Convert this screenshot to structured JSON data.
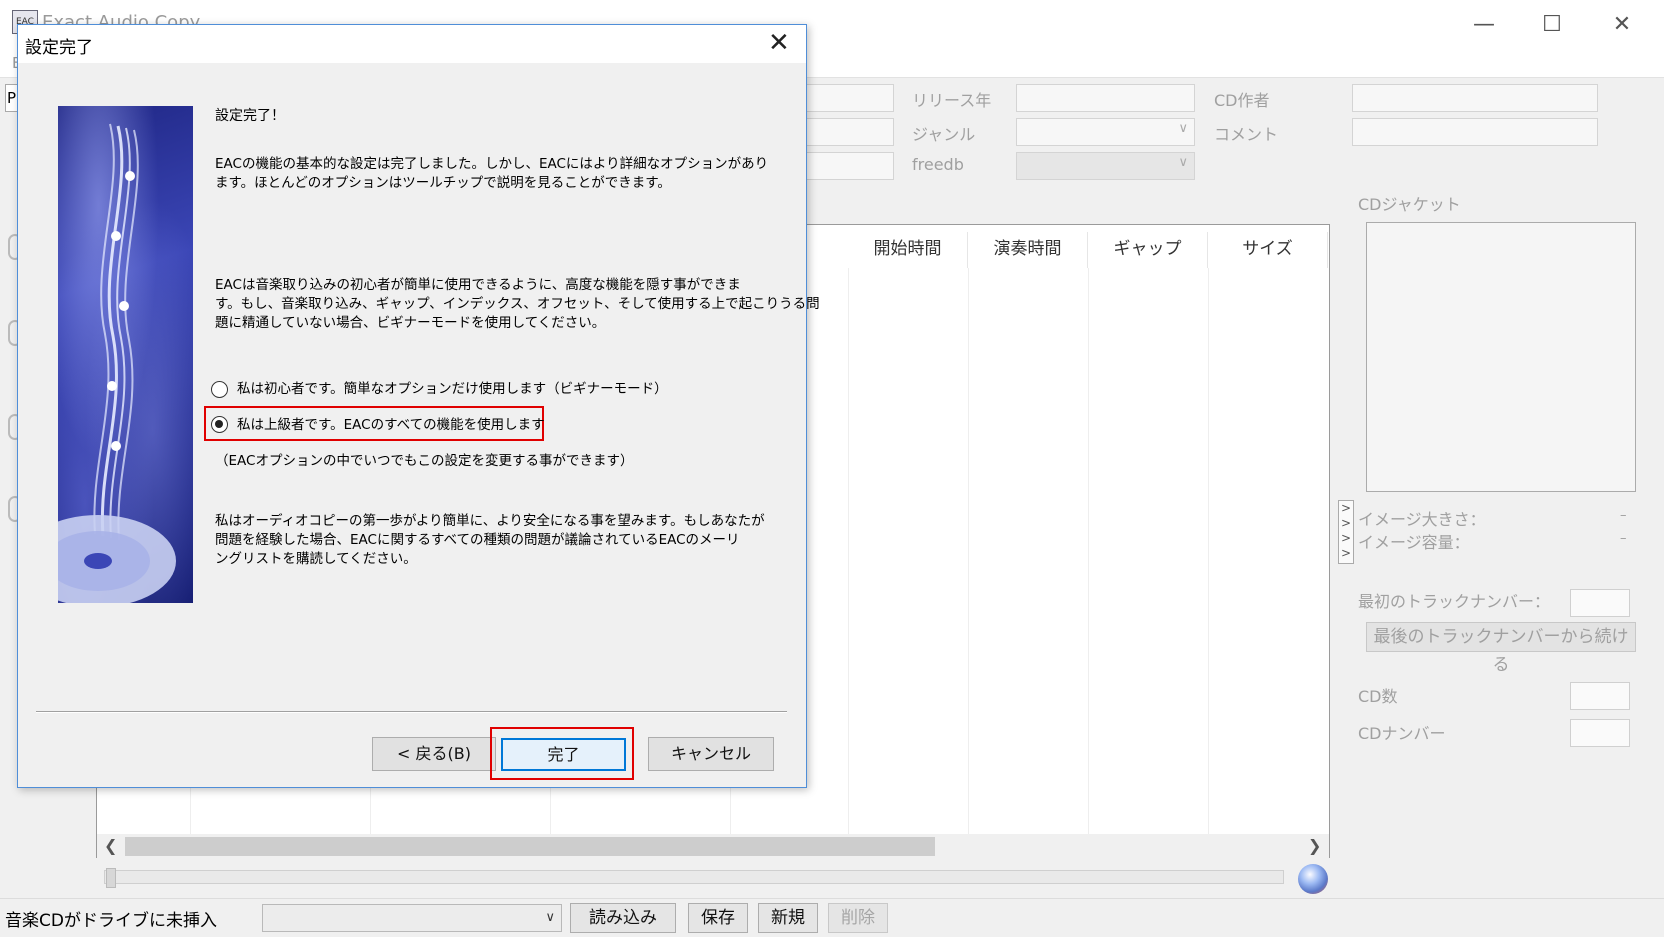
{
  "window": {
    "title": "Exact Audio Copy",
    "menu_first": "E",
    "toolbar_first": "P"
  },
  "metadata_fields": {
    "release_year_label": "リリース年",
    "cd_author_label": "CD作者",
    "genre_label": "ジャンル",
    "comment_label": "コメント",
    "freedb_label": "freedb"
  },
  "track_columns": [
    "開始時間",
    "演奏時間",
    "ギャップ",
    "サイズ"
  ],
  "cd_jacket": {
    "label": "CDジャケット",
    "image_size_label": "イメージ大きさ：",
    "image_size_value": "–",
    "image_capacity_label": "イメージ容量：",
    "image_capacity_value": "–"
  },
  "track_number": {
    "first_label": "最初のトラックナンバー：",
    "continue_button": "最後のトラックナンバーから続ける",
    "cd_count_label": "CD数",
    "cd_number_label": "CDナンバー"
  },
  "status_bar": {
    "status_text": "音楽CDがドライブに未挿入",
    "load_button": "読み込み",
    "save_button": "保存",
    "new_button": "新規",
    "delete_button": "削除"
  },
  "dialog": {
    "title": "設定完了",
    "heading": "設定完了！",
    "paragraph1_line1": "EACの機能の基本的な設定は完了しました。しかし、EACにはより詳細なオプションがあり",
    "paragraph1_line2": "ます。ほとんどのオプションはツールチップで説明を見ることができます。",
    "paragraph2_line1": "EACは音楽取り込みの初心者が簡単に使用できるように、高度な機能を隠す事ができま",
    "paragraph2_line2": "す。もし、音楽取り込み、ギャップ、インデックス、オフセット、そして使用する上で起こりうる問",
    "paragraph2_line3": "題に精通していない場合、ビギナーモードを使用してください。",
    "option_beginner": "私は初心者です。簡単なオプションだけ使用します（ビギナーモード）",
    "option_expert": "私は上級者です。EACのすべての機能を使用します",
    "option_note": "（EACオプションの中でいつでもこの設定を変更する事ができます）",
    "paragraph3_line1": "私はオーディオコピーの第一歩がより簡単に、より安全になる事を望みます。もしあなたが",
    "paragraph3_line2": "問題を経験した場合、EACに関するすべての種類の問題が議論されているEACのメーリ",
    "paragraph3_line3": "ングリストを購読してください。",
    "back_button": "< 戻る(B)",
    "finish_button": "完了",
    "cancel_button": "キャンセル",
    "selected_option": "expert"
  },
  "colors": {
    "highlight": "#e00000",
    "dialog_border": "#4f8ed8",
    "default_button_border": "#0078d7"
  }
}
